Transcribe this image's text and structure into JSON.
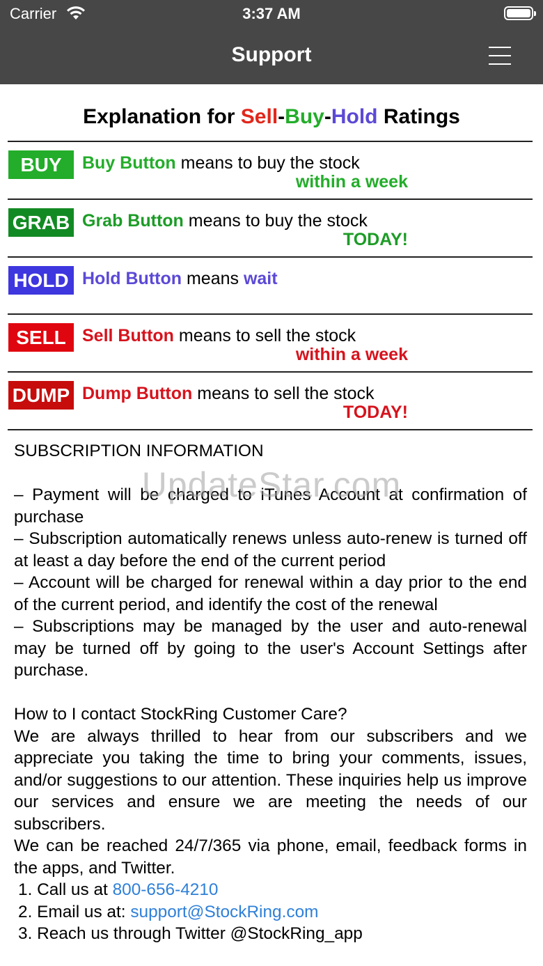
{
  "status_bar": {
    "carrier": "Carrier",
    "time": "3:37 AM",
    "wifi_icon": "wifi-icon",
    "battery_icon": "battery-icon"
  },
  "nav": {
    "title": "Support",
    "menu_icon": "hamburger-menu-icon"
  },
  "ratings_title": {
    "prefix": "Explanation for ",
    "sell": "Sell",
    "dash1": "-",
    "buy": "Buy",
    "dash2": "-",
    "hold": "Hold",
    "suffix": " Ratings"
  },
  "colors": {
    "nav_background": "#474747",
    "buy": "#23ad2a",
    "grab": "#128a23",
    "hold": "#3e36de",
    "sell": "#e0060f",
    "dump": "#c70c0c",
    "link": "#2f80d8"
  },
  "ratings": [
    {
      "badge": "BUY",
      "badge_color": "#23ad2a",
      "text_color": "#23ad2a",
      "highlight": "Buy Button",
      "description": " means to buy the stock",
      "timing": "within a week"
    },
    {
      "badge": "GRAB",
      "badge_color": "#128a23",
      "text_color": "#1c9c26",
      "highlight": "Grab Button",
      "description": " means to buy the stock",
      "timing": "TODAY!"
    },
    {
      "badge": "HOLD",
      "badge_color": "#3e36de",
      "text_color": "#5b49d6",
      "highlight": "Hold Button",
      "description": " means ",
      "inline_end": "wait",
      "timing": ""
    },
    {
      "badge": "SELL",
      "badge_color": "#e0060f",
      "text_color": "#d6131d",
      "highlight": "Sell Button",
      "description": " means to sell the stock",
      "timing": "within a week"
    },
    {
      "badge": "DUMP",
      "badge_color": "#c70c0c",
      "text_color": "#d6131d",
      "highlight": "Dump Button",
      "description": " means to sell the stock",
      "timing": "TODAY!"
    }
  ],
  "subscription": {
    "heading": "SUBSCRIPTION INFORMATION",
    "bullets": [
      "– Payment will be charged to iTunes Account at confirmation of purchase",
      "– Subscription automatically renews unless auto-renew is turned off at least a day before the end of the current period",
      "– Account will be charged for renewal within a day prior to the end of the current period, and identify the cost of the renewal",
      "– Subscriptions may be managed by the user and auto-renewal may be turned off by going to the user's Account Settings after purchase."
    ]
  },
  "contact": {
    "question": "How to I contact StockRing Customer Care?",
    "paragraph1": "We are always thrilled to hear from our subscribers and we appreciate you taking the time to bring your comments, issues, and/or suggestions to our attention. These inquiries help us improve our services and ensure we are meeting the needs of our subscribers.",
    "paragraph2": "We can be reached 24/7/365 via phone, email, feedback forms in the apps, and Twitter.",
    "item1_prefix": "1. Call us at ",
    "item1_phone": "800-656-4210",
    "item2_prefix": "2. Email us at: ",
    "item2_email": "support@StockRing.com",
    "item3": "3. Reach us through Twitter @StockRing_app"
  },
  "watermark": "UpdateStar.com"
}
